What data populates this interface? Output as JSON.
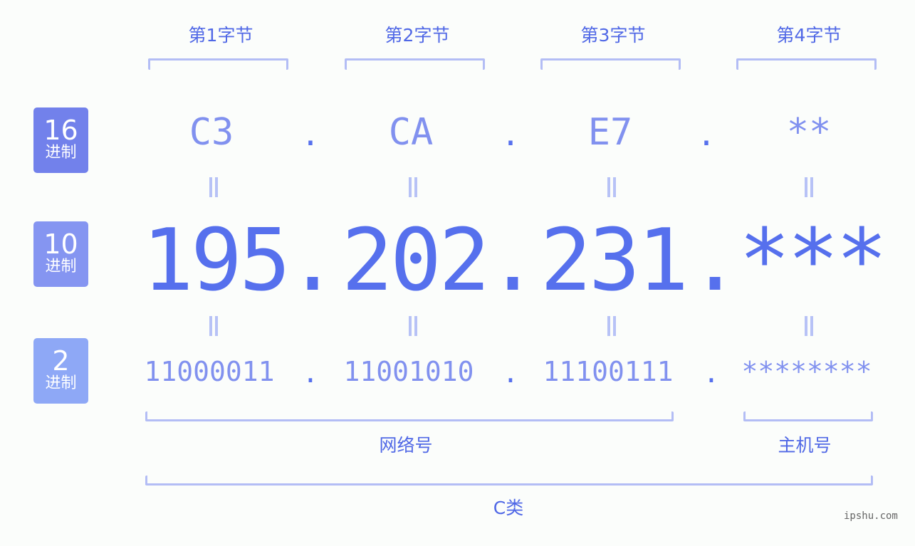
{
  "colors": {
    "background": "#fbfdfb",
    "accent": "#5670ed",
    "secondary_text": "#8191ef",
    "bracket": "#b3bdf5",
    "badge_hex": "#7281eb",
    "badge_dec": "#8595f1",
    "badge_bin": "#8ea8f6"
  },
  "byte_labels": [
    "第1字节",
    "第2字节",
    "第3字节",
    "第4字节"
  ],
  "badges": {
    "hex": {
      "num": "16",
      "unit": "进制"
    },
    "dec": {
      "num": "10",
      "unit": "进制"
    },
    "bin": {
      "num": "2",
      "unit": "进制"
    }
  },
  "separator": ".",
  "equals_symbol": "=",
  "hex_values": [
    "C3",
    "CA",
    "E7",
    "**"
  ],
  "dec_values": [
    "195",
    "202",
    "231",
    "***"
  ],
  "bin_values": [
    "11000011",
    "11001010",
    "11100111",
    "********"
  ],
  "groups": {
    "network": "网络号",
    "host": "主机号",
    "class": "C类"
  },
  "watermark": "ipshu.com"
}
